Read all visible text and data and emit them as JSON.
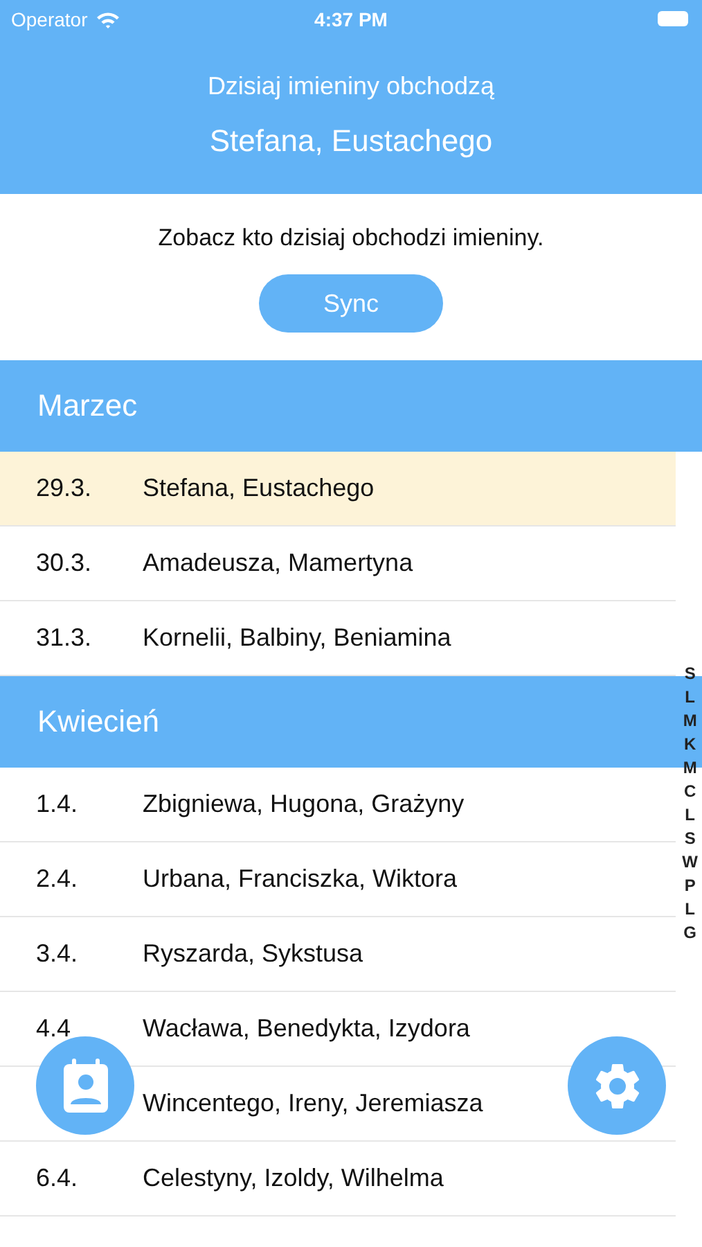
{
  "status_bar": {
    "carrier": "Operator",
    "time": "4:37 PM"
  },
  "header": {
    "subtitle": "Dzisiaj imieniny obchodzą",
    "names": "Stefana, Eustachego"
  },
  "sync": {
    "text": "Zobacz kto dzisiaj obchodzi imieniny.",
    "button": "Sync"
  },
  "sections": [
    {
      "title": "Marzec",
      "rows": [
        {
          "date": "29.3.",
          "names": "Stefana, Eustachego",
          "selected": true
        },
        {
          "date": "30.3.",
          "names": "Amadeusza, Mamertyna",
          "selected": false
        },
        {
          "date": "31.3.",
          "names": "Kornelii, Balbiny, Beniamina",
          "selected": false
        }
      ]
    },
    {
      "title": "Kwiecień",
      "rows": [
        {
          "date": "1.4.",
          "names": "Zbigniewa, Hugona, Grażyny",
          "selected": false
        },
        {
          "date": "2.4.",
          "names": "Urbana, Franciszka, Wiktora",
          "selected": false
        },
        {
          "date": "3.4.",
          "names": "Ryszarda, Sykstusa",
          "selected": false
        },
        {
          "date": "4.4",
          "names": "Wacława, Benedykta, Izydora",
          "selected": false
        },
        {
          "names": "Wincentego, Ireny, Jeremiasza",
          "selected": false
        },
        {
          "date": "6.4.",
          "names": "Celestyny, Izoldy, Wilhelma",
          "selected": false
        }
      ]
    }
  ],
  "index": [
    "S",
    "L",
    "M",
    "K",
    "M",
    "C",
    "L",
    "S",
    "W",
    "P",
    "L",
    "G"
  ]
}
